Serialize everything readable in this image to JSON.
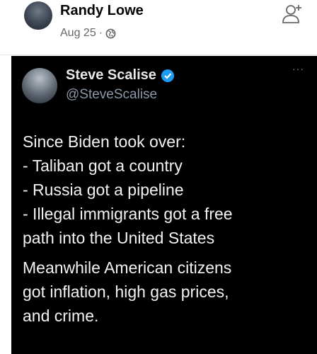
{
  "post": {
    "author": "Randy Lowe",
    "date": "Aug 25",
    "separator": "·",
    "privacy_icon": "globe-icon",
    "action_icon": "add-friend-icon"
  },
  "tweet": {
    "name": "Steve Scalise",
    "handle": "@SteveScalise",
    "verified_icon": "verified-badge-icon",
    "more_label": "···",
    "body_lines": [
      "Since Biden took over:",
      "- Taliban got a country",
      "- Russia got a pipeline",
      "- Illegal immigrants got a free",
      "path into the United States",
      "Meanwhile American citizens",
      "got inflation, high gas prices,",
      "and crime."
    ]
  },
  "colors": {
    "tweet_background": "#000000",
    "verified_blue": "#1d9bf0",
    "meta_gray": "#65676b"
  }
}
